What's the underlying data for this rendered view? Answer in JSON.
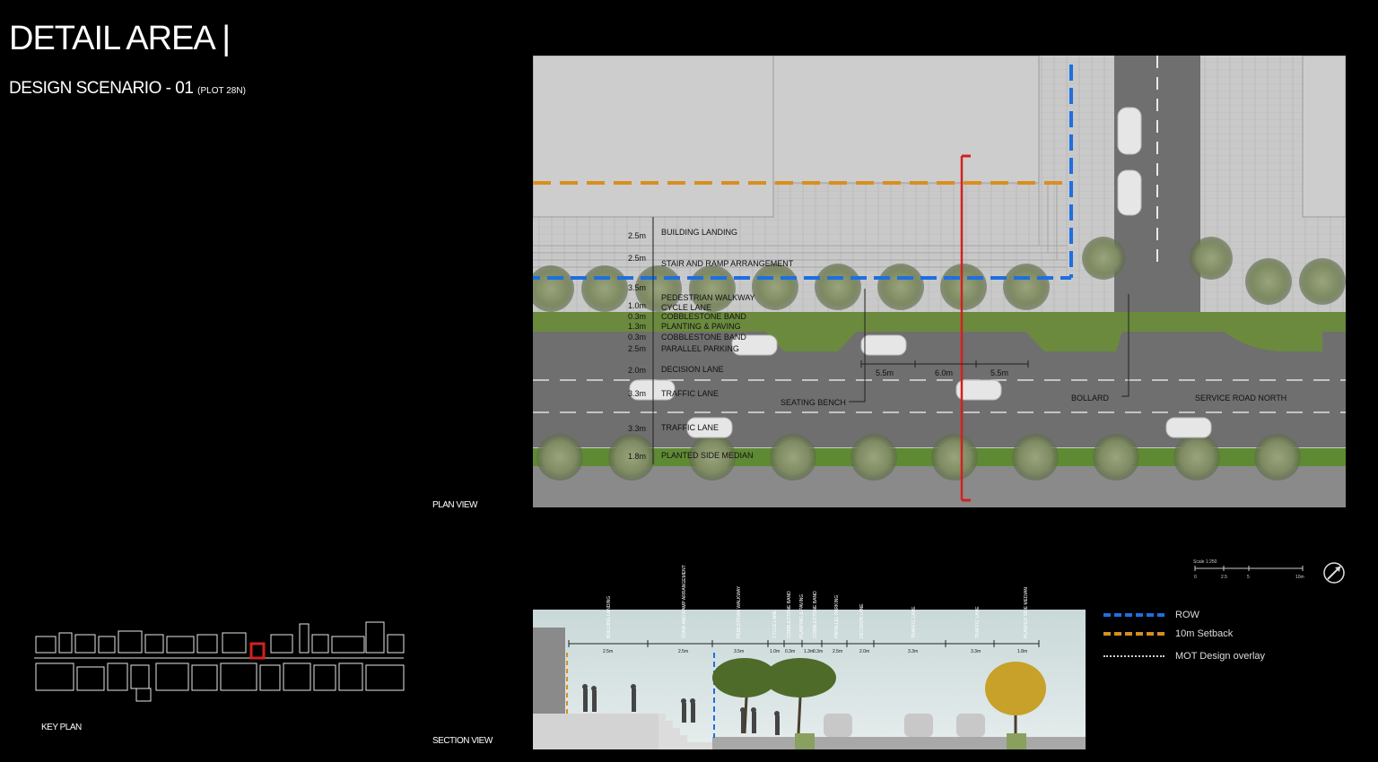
{
  "header": {
    "title": "DETAIL AREA |",
    "subtitle_main": "DESIGN SCENARIO - 01",
    "subtitle_plot": "(PLOT 28N)"
  },
  "captions": {
    "plan_view": "PLAN VIEW",
    "section_view": "SECTION VIEW",
    "key_plan": "KEY PLAN"
  },
  "plan": {
    "zones": [
      {
        "width": "2.5m",
        "label": "BUILDING LANDING"
      },
      {
        "width": "2.5m",
        "label": "STAIR AND RAMP ARRANGEMENT"
      },
      {
        "width": "3.5m",
        "label": "PEDESTRIAN WALKWAY"
      },
      {
        "width": "1.0m",
        "label": "CYCLE LANE"
      },
      {
        "width": "0.3m",
        "label": "COBBLESTONE BAND"
      },
      {
        "width": "1.3m",
        "label": "PLANTING & PAVING"
      },
      {
        "width": "0.3m",
        "label": "COBBLESTONE BAND"
      },
      {
        "width": "2.5m",
        "label": "PARALLEL PARKING"
      },
      {
        "width": "2.0m",
        "label": "DECISION LANE"
      },
      {
        "width": "3.3m",
        "label": "TRAFFIC LANE"
      },
      {
        "width": "3.3m",
        "label": "TRAFFIC LANE"
      },
      {
        "width": "1.8m",
        "label": "PLANTED SIDE MEDIAN"
      }
    ],
    "bench_dims": [
      "5.5m",
      "6.0m",
      "5.5m"
    ],
    "callouts": {
      "seating_bench": "SEATING BENCH",
      "bollard": "BOLLARD",
      "service_road": "SERVICE ROAD NORTH"
    }
  },
  "legend": {
    "items": [
      {
        "label": "ROW",
        "color": "#1e6fe0",
        "style": "dashed"
      },
      {
        "label": "10m Setback",
        "color": "#d98e1e",
        "style": "dashed"
      },
      {
        "label": "MOT Design overlay",
        "color": "#cfcfcf",
        "style": "dotted"
      }
    ]
  },
  "scale": {
    "title": "Scale 1:250",
    "ticks": [
      "0",
      "2.5",
      "5",
      "10m"
    ]
  },
  "colors": {
    "row": "#1e6fe0",
    "setback": "#d98e1e",
    "section_cut": "#d42020",
    "keyplan_highlight": "#d42020"
  }
}
